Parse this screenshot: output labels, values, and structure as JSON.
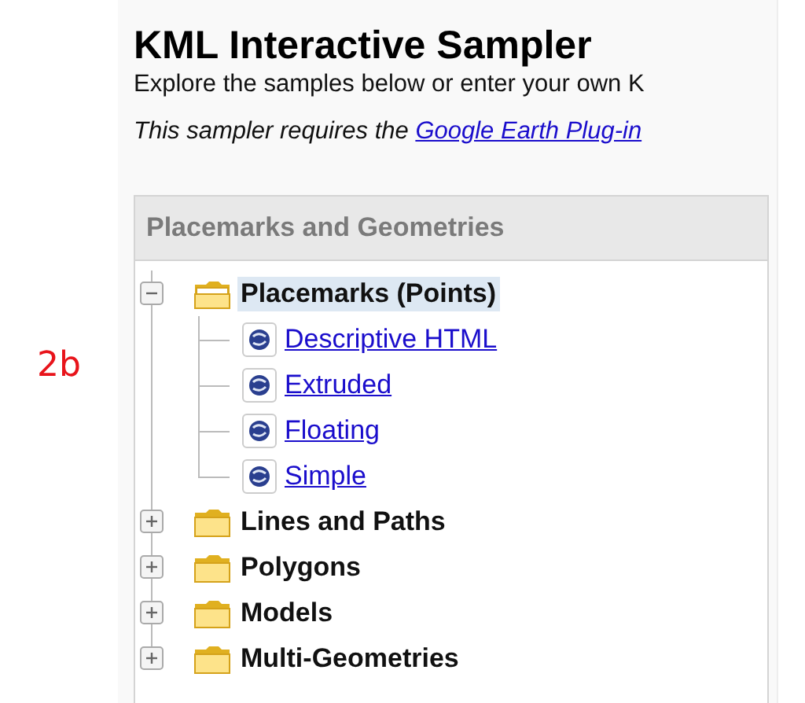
{
  "annotation": "2b",
  "title": "KML Interactive Sampler",
  "intro": "Explore the samples below or enter your own K",
  "requirement": {
    "text": "This sampler requires the ",
    "link": "Google Earth Plug-in"
  },
  "panel": {
    "title": "Placemarks and Geometries",
    "tree": [
      {
        "label": "Placemarks (Points)",
        "expanded": true,
        "selected": true,
        "children": [
          {
            "label": "Descriptive HTML"
          },
          {
            "label": "Extruded"
          },
          {
            "label": "Floating"
          },
          {
            "label": "Simple"
          }
        ]
      },
      {
        "label": "Lines and Paths",
        "expanded": false,
        "selected": false
      },
      {
        "label": "Polygons",
        "expanded": false,
        "selected": false
      },
      {
        "label": "Models",
        "expanded": false,
        "selected": false
      },
      {
        "label": "Multi-Geometries",
        "expanded": false,
        "selected": false
      }
    ]
  }
}
